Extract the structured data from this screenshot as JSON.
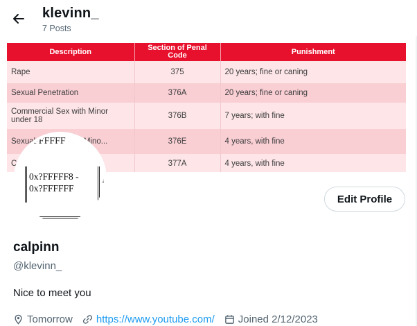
{
  "header": {
    "name": "klevinn_",
    "posts": "7 Posts"
  },
  "banner_table": {
    "columns": [
      "Description",
      "Section of Penal Code",
      "Punishment"
    ],
    "rows": [
      {
        "description": "Rape",
        "code": "375",
        "punishment": "20 years; fine or caning"
      },
      {
        "description": "Sexual Penetration",
        "code": "376A",
        "punishment": "20 years; fine or caning"
      },
      {
        "description": "Commercial Sex with Minor under 18",
        "code": "376B",
        "punishment": "7 years; with fine"
      },
      {
        "description": "Sexual Grooming of Mino...",
        "code": "376E",
        "punishment": "4 years, with fine"
      },
      {
        "description": "C...ncy",
        "code": "377A",
        "punishment": "4 years, with fine"
      }
    ]
  },
  "avatar": {
    "glyph_top": "FFFFFF",
    "glyph_line1": "0x?FFFFF8 -",
    "glyph_line2": "0x?FFFFFF",
    "glyph_tick": "a"
  },
  "profile": {
    "display_name": "calpinn",
    "handle": "@klevinn_",
    "bio": "Nice to meet you",
    "edit_button": "Edit Profile",
    "location": "Tomorrow",
    "website": "https://www.youtube.com/",
    "joined": "Joined 2/12/2023"
  },
  "colors": {
    "table_header": "#e8112d",
    "link": "#1d9bf0",
    "muted": "#536471"
  }
}
